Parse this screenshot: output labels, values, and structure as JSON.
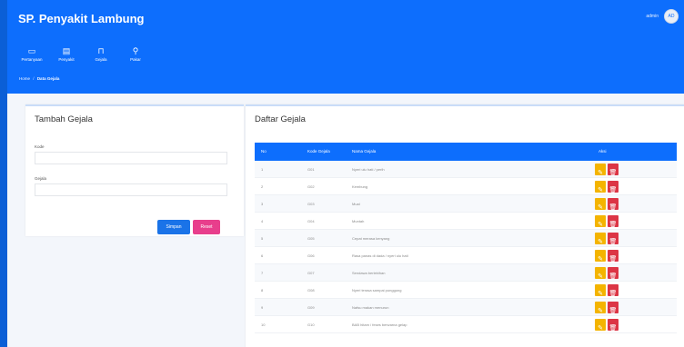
{
  "app": {
    "title": "SP. Penyakit Lambung",
    "user_name": "admin",
    "avatar_text": "AD"
  },
  "nav": [
    {
      "label": "Pertanyaan",
      "icon": "monitor-icon",
      "glyph": "▭"
    },
    {
      "label": "Penyakit",
      "icon": "file-icon",
      "glyph": "▤"
    },
    {
      "label": "Gejala",
      "icon": "folder-icon",
      "glyph": "⊓"
    },
    {
      "label": "Pakar",
      "icon": "user-icon",
      "glyph": "⚲"
    }
  ],
  "breadcrumb": {
    "home": "Home",
    "separator": "/",
    "current": "Data Gejala"
  },
  "form": {
    "title": "Tambah Gejala",
    "kode_label": "Kode",
    "kode_value": "",
    "gejala_label": "Gejala",
    "gejala_value": "",
    "save_label": "Simpan",
    "reset_label": "Reset"
  },
  "table": {
    "title": "Daftar Gejala",
    "headers": {
      "no": "No",
      "kode": "Kode Gejala",
      "nama": "Nama Gejala",
      "aksi": "Aksi"
    },
    "rows": [
      {
        "no": "1",
        "kode": "G01",
        "nama": "Nyeri ulu hati / perih"
      },
      {
        "no": "2",
        "kode": "G02",
        "nama": "Kembung"
      },
      {
        "no": "3",
        "kode": "G03",
        "nama": "Mual"
      },
      {
        "no": "4",
        "kode": "G04",
        "nama": "Muntah"
      },
      {
        "no": "5",
        "kode": "G05",
        "nama": "Cepat merasa kenyang"
      },
      {
        "no": "6",
        "kode": "G06",
        "nama": "Rasa panas di dada / nyeri ulu hati"
      },
      {
        "no": "7",
        "kode": "G07",
        "nama": "Sendawa berlebihan"
      },
      {
        "no": "8",
        "kode": "G08",
        "nama": "Nyeri terasa sampai punggung"
      },
      {
        "no": "9",
        "kode": "G09",
        "nama": "Nafsu makan menurun"
      },
      {
        "no": "10",
        "kode": "G10",
        "nama": "BAB hitam / feses berwarna gelap"
      }
    ],
    "edit_glyph": "✎",
    "delete_glyph": "🗑"
  },
  "colors": {
    "primary": "#0d6efd",
    "edit": "#f4b400",
    "delete": "#dc3545",
    "reset": "#e83e8c"
  }
}
